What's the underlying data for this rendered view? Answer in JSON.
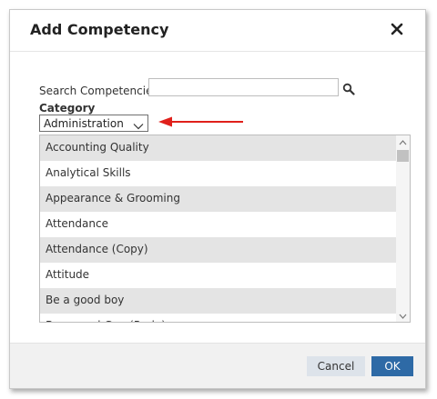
{
  "dialog": {
    "title": "Add Competency",
    "close_icon": "close-icon"
  },
  "search": {
    "label": "Search Competencies:",
    "value": "",
    "placeholder": "",
    "icon": "search-icon"
  },
  "category": {
    "label": "Category",
    "selected": "Administration",
    "icon": "chevron-down-icon"
  },
  "annotation": {
    "icon": "red-arrow-icon",
    "color": "#e0201b"
  },
  "competencies": [
    "Accounting Quality",
    "Analytical Skills",
    "Appearance & Grooming",
    "Attendance",
    "Attendance (Copy)",
    "Attitude",
    "Be a good boy",
    "Be a good Guy (Rude)"
  ],
  "footer": {
    "cancel_label": "Cancel",
    "ok_label": "OK"
  },
  "colors": {
    "ok_button": "#2e6aa6",
    "cancel_button": "#dde3ea",
    "row_shade": "#e4e4e4"
  }
}
